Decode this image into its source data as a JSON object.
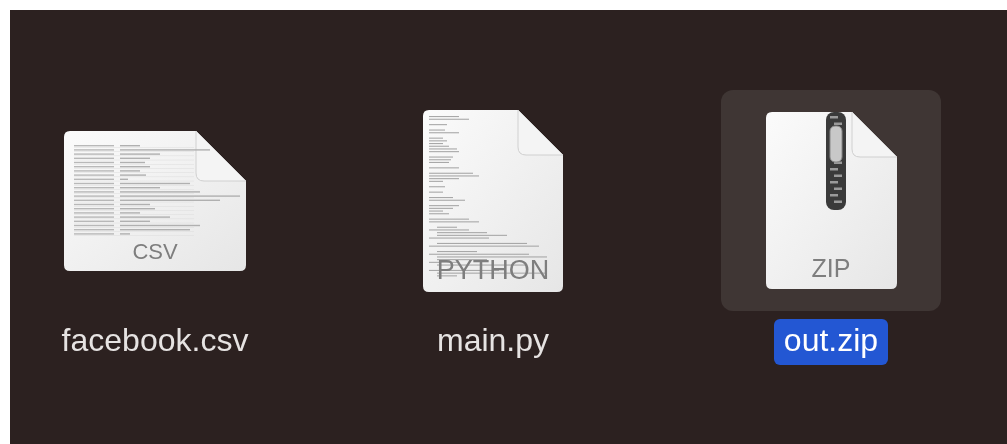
{
  "files": [
    {
      "name": "facebook.csv",
      "kind": "csv",
      "type_label": "CSV",
      "selected": false
    },
    {
      "name": "main.py",
      "kind": "python",
      "type_label": "PYTHON",
      "selected": false
    },
    {
      "name": "out.zip",
      "kind": "zip",
      "type_label": "ZIP",
      "selected": true
    }
  ]
}
